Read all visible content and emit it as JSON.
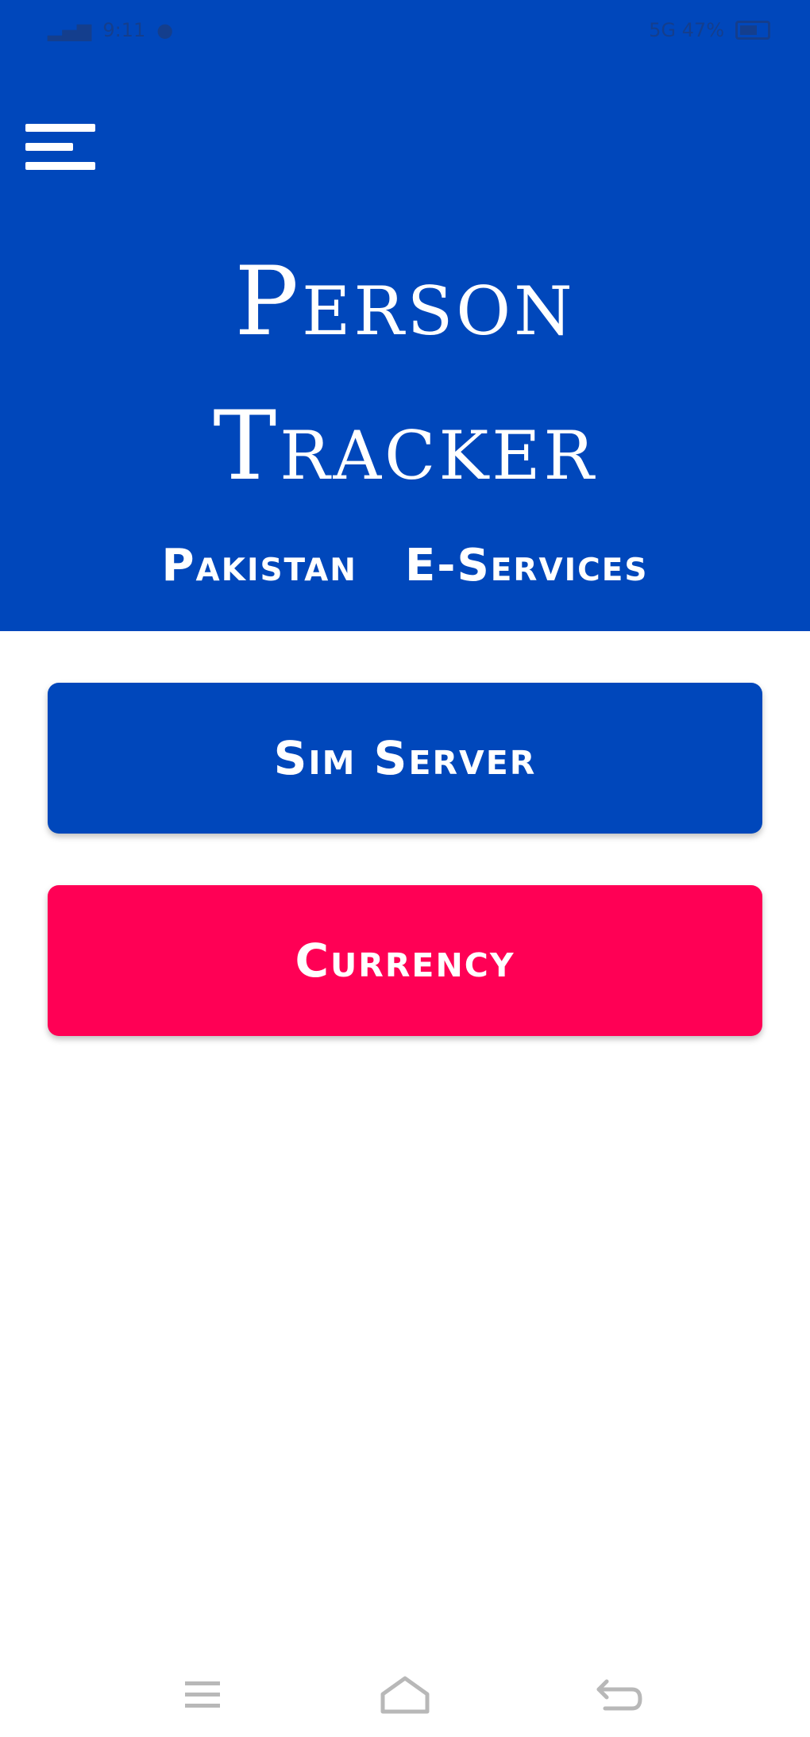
{
  "status_bar": {
    "left_text": "9:11",
    "right_text": "5G 47%"
  },
  "header": {
    "title_line1": "Person",
    "title_line2": "Tracker",
    "subtitle_left": "Pakistan",
    "subtitle_right": "E-Services",
    "background_color": "#0047BB"
  },
  "buttons": {
    "sim_server": "Sim Server",
    "currency": "Currency"
  },
  "colors": {
    "primary": "#0047BB",
    "accent": "#FF0055"
  },
  "icons": {
    "menu": "hamburger-menu-icon",
    "nav_recent": "recent-apps-icon",
    "nav_home": "home-icon",
    "nav_back": "back-icon"
  }
}
